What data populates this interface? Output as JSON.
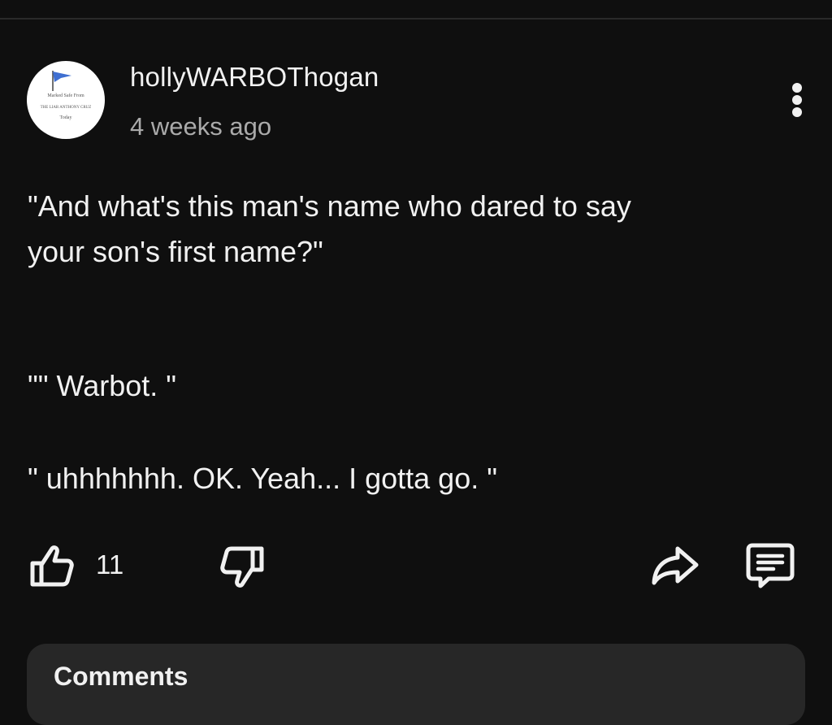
{
  "post": {
    "author": "hollyWARBOThogan",
    "timestamp": "4 weeks ago",
    "avatar": {
      "line1": "Marked Safe From",
      "line2": "THE LIAR ANTHONY CRUZ",
      "line3": "Today"
    },
    "body": {
      "line1": "\"And what's this man's name who dared to say",
      "line2": "your son's first name?\"",
      "line3": "\"\" Warbot. \"",
      "line4": "\" uhhhhhhh. OK. Yeah... I gotta go. \""
    }
  },
  "actions": {
    "like_count": "11",
    "icons": [
      "thumbs-up-icon",
      "thumbs-down-icon",
      "share-icon",
      "comment-icon"
    ]
  },
  "comments": {
    "label": "Comments"
  },
  "colors": {
    "background": "#0f0f0f",
    "text": "#f1f1f1",
    "secondary_text": "#aaaaaa",
    "panel": "#272727"
  }
}
